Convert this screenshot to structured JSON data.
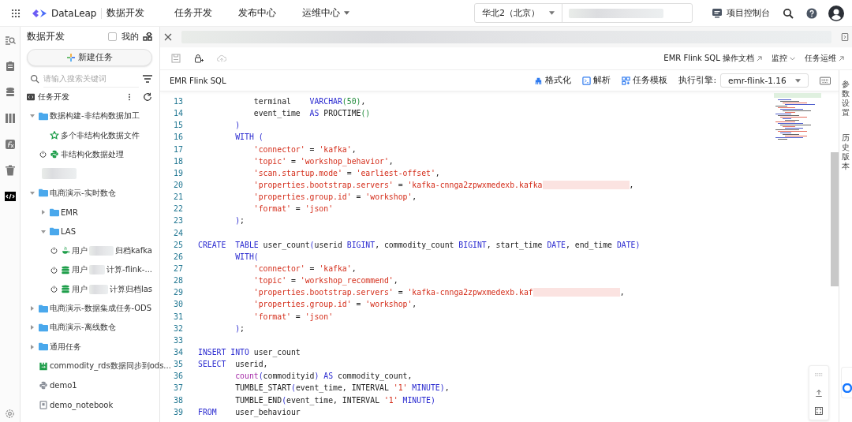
{
  "topbar": {
    "brand": "DataLeap",
    "module": "数据开发",
    "nav": [
      {
        "label": "任务开发",
        "dropdown": false
      },
      {
        "label": "发布中心",
        "dropdown": false
      },
      {
        "label": "运维中心",
        "dropdown": true
      }
    ],
    "region": "华北2（北京）",
    "console": "项目控制台"
  },
  "rail": [
    {
      "selected": false
    },
    {
      "selected": false
    },
    {
      "selected": false
    },
    {
      "selected": false
    },
    {
      "selected": false
    },
    {
      "selected": false
    },
    {
      "selected": true
    }
  ],
  "sidebar": {
    "title": "数据开发",
    "mine": {
      "label": "我的",
      "checked": false
    },
    "new_button": "新建任务",
    "search": {
      "placeholder": "请输入搜索关键词"
    },
    "root": "任务开发",
    "tree": [
      {
        "kind": "folder",
        "name": "数据构建-非结构数据加工",
        "expanded": true,
        "children": [
          {
            "kind": "star-task",
            "name": "多个非结构化数据文件",
            "scheduled": false
          },
          {
            "kind": "python-task",
            "name": "非结构化数据处理",
            "scheduled": true
          }
        ]
      },
      {
        "kind": "redacted"
      },
      {
        "kind": "folder",
        "name": "电商演示-实时数仓",
        "expanded": true,
        "children": [
          {
            "kind": "folder",
            "name": "EMR",
            "expanded": false
          },
          {
            "kind": "folder",
            "name": "LAS",
            "expanded": true,
            "children": [
              {
                "kind": "java-task",
                "name": "用户",
                "name_end": "归档kafka",
                "scheduled": true
              },
              {
                "kind": "sql-task",
                "name": "用户",
                "name_end": "计算-flink-...",
                "scheduled": true
              },
              {
                "kind": "sql-task",
                "name": "用户",
                "name_end": "计算归档las",
                "scheduled": true
              }
            ]
          }
        ]
      },
      {
        "kind": "folder",
        "name": "电商演示-数据集成任务-ODS",
        "expanded": false
      },
      {
        "kind": "folder",
        "name": "电商演示-离线数仓",
        "expanded": false
      },
      {
        "kind": "folder",
        "name": "通用任务",
        "expanded": false
      },
      {
        "kind": "sync-task",
        "name": "commodity_rds数据同步到ods...",
        "scheduled": false
      },
      {
        "kind": "python-task",
        "name": "demo1",
        "scheduled": false
      },
      {
        "kind": "notebook-task",
        "name": "demo_notebook",
        "scheduled": false
      }
    ]
  },
  "toolbar": {
    "links": [
      {
        "label": "EMR Flink SQL 操作文档",
        "kind": "external"
      },
      {
        "label": "监控",
        "kind": "dropdown"
      },
      {
        "label": "任务运维",
        "kind": "external"
      }
    ]
  },
  "editor": {
    "language": "EMR Flink SQL",
    "tools": [
      {
        "label": "格式化",
        "kind": "format"
      },
      {
        "label": "解析",
        "kind": "parse"
      },
      {
        "label": "任务模板",
        "kind": "template"
      }
    ],
    "engine_label": "执行引擎:",
    "engine": "emr-flink-1.16",
    "lines": [
      {
        "n": "13",
        "tokens": [
          {
            "kind": "plain",
            "text": "            terminal    "
          },
          {
            "kind": "keyword",
            "text": "VARCHAR"
          },
          {
            "kind": "number",
            "text": "(50)"
          },
          {
            "kind": "plain",
            "text": ","
          }
        ]
      },
      {
        "n": "14",
        "tokens": [
          {
            "kind": "plain",
            "text": "            event_time  "
          },
          {
            "kind": "keyword",
            "text": "AS"
          },
          {
            "kind": "plain",
            "text": " PROCTIME"
          },
          {
            "kind": "number",
            "text": "()"
          }
        ]
      },
      {
        "n": "15",
        "tokens": [
          {
            "kind": "keyword",
            "text": "        )"
          }
        ]
      },
      {
        "n": "16",
        "tokens": [
          {
            "kind": "keyword",
            "text": "        WITH ("
          }
        ]
      },
      {
        "n": "17",
        "tokens": [
          {
            "kind": "string",
            "text": "            'connector'"
          },
          {
            "kind": "plain",
            "text": " = "
          },
          {
            "kind": "string",
            "text": "'kafka'"
          },
          {
            "kind": "plain",
            "text": ","
          }
        ]
      },
      {
        "n": "18",
        "tokens": [
          {
            "kind": "string",
            "text": "            'topic'"
          },
          {
            "kind": "plain",
            "text": " = "
          },
          {
            "kind": "string",
            "text": "'workshop_behavior'"
          },
          {
            "kind": "plain",
            "text": ","
          }
        ]
      },
      {
        "n": "19",
        "tokens": [
          {
            "kind": "string",
            "text": "            'scan.startup.mode'"
          },
          {
            "kind": "plain",
            "text": " = "
          },
          {
            "kind": "string",
            "text": "'earliest-offset'"
          },
          {
            "kind": "plain",
            "text": ","
          }
        ]
      },
      {
        "n": "20",
        "tokens": [
          {
            "kind": "string",
            "text": "            'properties.bootstrap.servers'"
          },
          {
            "kind": "plain",
            "text": " = "
          },
          {
            "kind": "string",
            "text": "'kafka-cnnga2zpwxmedexb.kafka"
          },
          {
            "kind": "redacted"
          },
          {
            "kind": "plain",
            "text": ","
          }
        ]
      },
      {
        "n": "21",
        "tokens": [
          {
            "kind": "string",
            "text": "            'properties.group.id'"
          },
          {
            "kind": "plain",
            "text": " = "
          },
          {
            "kind": "string",
            "text": "'workshop'"
          },
          {
            "kind": "plain",
            "text": ","
          }
        ]
      },
      {
        "n": "22",
        "tokens": [
          {
            "kind": "string",
            "text": "            'format'"
          },
          {
            "kind": "plain",
            "text": " = "
          },
          {
            "kind": "string",
            "text": "'json'"
          }
        ]
      },
      {
        "n": "23",
        "tokens": [
          {
            "kind": "keyword",
            "text": "        )"
          },
          {
            "kind": "plain",
            "text": ";"
          }
        ]
      },
      {
        "n": "24"
      },
      {
        "n": "25",
        "tokens": [
          {
            "kind": "keyword",
            "text": "CREATE  TABLE"
          },
          {
            "kind": "plain",
            "text": " user_count"
          },
          {
            "kind": "keyword",
            "text": "("
          },
          {
            "kind": "plain",
            "text": "userid "
          },
          {
            "kind": "keyword",
            "text": "BIGINT"
          },
          {
            "kind": "plain",
            "text": ", commodity_count "
          },
          {
            "kind": "keyword",
            "text": "BIGINT"
          },
          {
            "kind": "plain",
            "text": ", start_time "
          },
          {
            "kind": "keyword",
            "text": "DATE"
          },
          {
            "kind": "plain",
            "text": ", end_time "
          },
          {
            "kind": "keyword",
            "text": "DATE)"
          }
        ]
      },
      {
        "n": "26",
        "tokens": [
          {
            "kind": "keyword",
            "text": "        WITH("
          }
        ]
      },
      {
        "n": "27",
        "tokens": [
          {
            "kind": "string",
            "text": "            'connector'"
          },
          {
            "kind": "plain",
            "text": " = "
          },
          {
            "kind": "string",
            "text": "'kafka'"
          },
          {
            "kind": "plain",
            "text": ","
          }
        ]
      },
      {
        "n": "28",
        "tokens": [
          {
            "kind": "string",
            "text": "            'topic'"
          },
          {
            "kind": "plain",
            "text": " = "
          },
          {
            "kind": "string",
            "text": "'workshop_recommend'"
          },
          {
            "kind": "plain",
            "text": ","
          }
        ]
      },
      {
        "n": "29",
        "tokens": [
          {
            "kind": "string",
            "text": "            'properties.bootstrap.servers'"
          },
          {
            "kind": "plain",
            "text": " = "
          },
          {
            "kind": "string",
            "text": "'kafka-cnnga2zpwxmedexb.kaf"
          },
          {
            "kind": "redacted"
          },
          {
            "kind": "plain",
            "text": ","
          }
        ]
      },
      {
        "n": "30",
        "tokens": [
          {
            "kind": "string",
            "text": "            'properties.group.id'"
          },
          {
            "kind": "plain",
            "text": " = "
          },
          {
            "kind": "string",
            "text": "'workshop'"
          },
          {
            "kind": "plain",
            "text": ","
          }
        ]
      },
      {
        "n": "31",
        "tokens": [
          {
            "kind": "string",
            "text": "            'format'"
          },
          {
            "kind": "plain",
            "text": " = "
          },
          {
            "kind": "string",
            "text": "'json'"
          }
        ]
      },
      {
        "n": "32",
        "tokens": [
          {
            "kind": "keyword",
            "text": "        )"
          },
          {
            "kind": "plain",
            "text": ";"
          }
        ]
      },
      {
        "n": "33"
      },
      {
        "n": "34",
        "tokens": [
          {
            "kind": "keyword",
            "text": "INSERT INTO"
          },
          {
            "kind": "plain",
            "text": " user_count"
          }
        ]
      },
      {
        "n": "35",
        "tokens": [
          {
            "kind": "keyword",
            "text": "SELECT"
          },
          {
            "kind": "plain",
            "text": "  userid,"
          }
        ]
      },
      {
        "n": "36",
        "tokens": [
          {
            "kind": "function",
            "text": "        count"
          },
          {
            "kind": "keyword",
            "text": "("
          },
          {
            "kind": "plain",
            "text": "commodityid"
          },
          {
            "kind": "keyword",
            "text": ")"
          },
          {
            "kind": "keyword",
            "text": " AS"
          },
          {
            "kind": "plain",
            "text": " commodity_count,"
          }
        ]
      },
      {
        "n": "37",
        "tokens": [
          {
            "kind": "plain",
            "text": "        TUMBLE_START"
          },
          {
            "kind": "keyword",
            "text": "("
          },
          {
            "kind": "plain",
            "text": "event_time, INTERVAL "
          },
          {
            "kind": "string",
            "text": "'1'"
          },
          {
            "kind": "keyword",
            "text": " MINUTE)"
          },
          {
            "kind": "plain",
            "text": ","
          }
        ]
      },
      {
        "n": "38",
        "tokens": [
          {
            "kind": "plain",
            "text": "        TUMBLE_END"
          },
          {
            "kind": "keyword",
            "text": "("
          },
          {
            "kind": "plain",
            "text": "event_time, INTERVAL "
          },
          {
            "kind": "string",
            "text": "'1'"
          },
          {
            "kind": "keyword",
            "text": " MINUTE)"
          }
        ]
      },
      {
        "n": "39",
        "tokens": [
          {
            "kind": "keyword",
            "text": "FROM"
          },
          {
            "kind": "plain",
            "text": "    user_behaviour"
          }
        ]
      }
    ]
  },
  "side_panel": [
    {
      "label": "参数设置"
    },
    {
      "label": "历史版本"
    }
  ]
}
